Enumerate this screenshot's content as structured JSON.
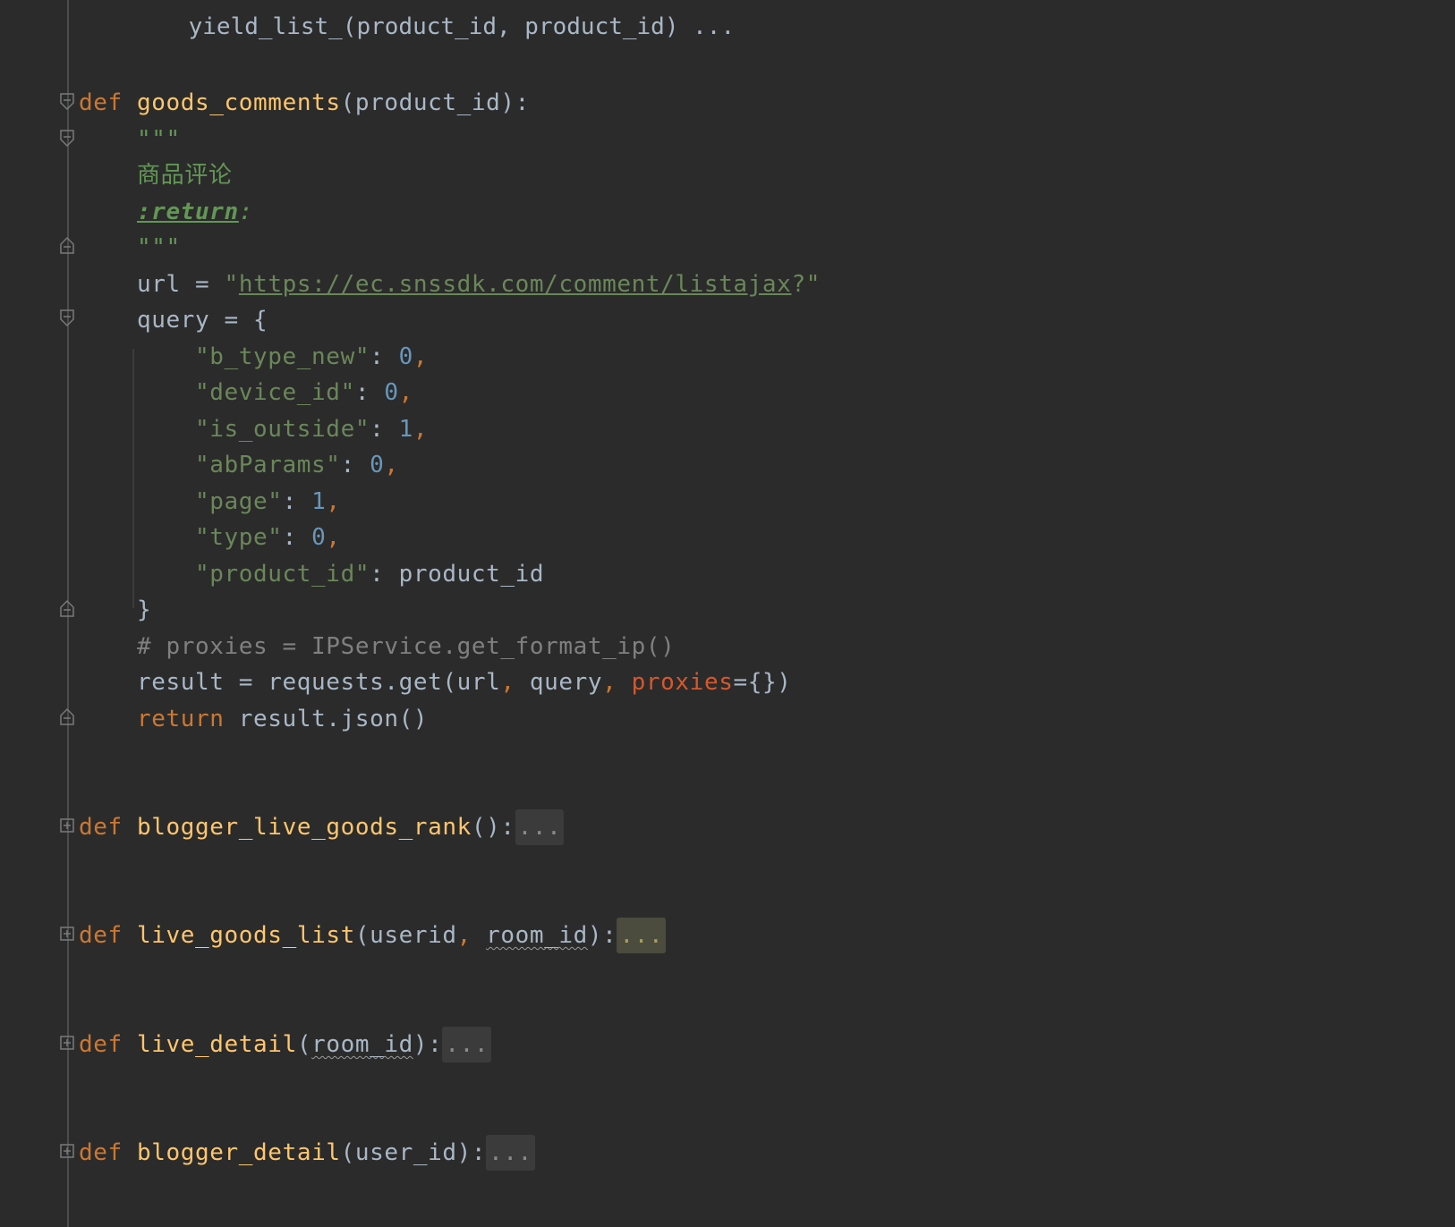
{
  "editor": {
    "language": "python",
    "top_partial": {
      "text": "yield_list_(product_id, product_id) ..."
    },
    "function_goods_comments": {
      "keyword": "def",
      "name": "goods_comments",
      "open_paren": "(",
      "params": "product_id",
      "close": "):",
      "doc_open": "\"\"\"",
      "doc_text": "商品评论",
      "doc_return_tag": ":return",
      "doc_return_colon": ":",
      "doc_close": "\"\"\"",
      "url_var": "url",
      "url_eq": " = ",
      "url_quote_open": "\"",
      "url_value": "https://ec.snssdk.com/comment/listajax",
      "url_tail": "?\"",
      "query_var": "query",
      "query_open": " = {",
      "query_items": [
        {
          "key": "\"b_type_new\"",
          "value": "0",
          "comma": ","
        },
        {
          "key": "\"device_id\"",
          "value": "0",
          "comma": ","
        },
        {
          "key": "\"is_outside\"",
          "value": "1",
          "comma": ","
        },
        {
          "key": "\"abParams\"",
          "value": "0",
          "comma": ","
        },
        {
          "key": "\"page\"",
          "value": "1",
          "comma": ","
        },
        {
          "key": "\"type\"",
          "value": "0",
          "comma": ","
        },
        {
          "key": "\"product_id\"",
          "value": "product_id",
          "comma": ""
        }
      ],
      "query_close": "}",
      "comment_line": "# proxies = IPService.get_format_ip()",
      "result_assign": "result = requests.get(url",
      "result_comma1": ", ",
      "result_query": "query",
      "result_comma2": ", ",
      "result_named": "proxies",
      "result_tail": "={})",
      "return_kw": "return",
      "return_expr": " result.json()"
    },
    "collapsed_functions": [
      {
        "keyword": "def",
        "name": "blogger_live_goods_rank",
        "signature_pre": "():",
        "param": "",
        "signature_post": "",
        "ellipsis": "...",
        "highlight": false
      },
      {
        "keyword": "def",
        "name": "live_goods_list",
        "signature_pre": "(userid, ",
        "param": "room_id",
        "signature_post": "):",
        "ellipsis": "...",
        "highlight": true
      },
      {
        "keyword": "def",
        "name": "live_detail",
        "signature_pre": "(",
        "param": "room_id",
        "signature_post": "):",
        "ellipsis": "...",
        "highlight": false
      },
      {
        "keyword": "def",
        "name": "blogger_detail",
        "signature_pre": "(user_id):",
        "param": "",
        "signature_post": "",
        "ellipsis": "...",
        "highlight": false
      }
    ],
    "colors": {
      "background": "#2b2b2b",
      "keyword": "#cc7832",
      "function": "#ffc66d",
      "string": "#6a8759",
      "number": "#6897bb",
      "comment": "#808080",
      "docstring": "#629755",
      "text": "#a9b7c6"
    },
    "icons": {
      "fold_open": "fold-collapse-icon",
      "fold_end": "fold-end-icon",
      "fold_closed": "fold-expand-icon"
    }
  }
}
